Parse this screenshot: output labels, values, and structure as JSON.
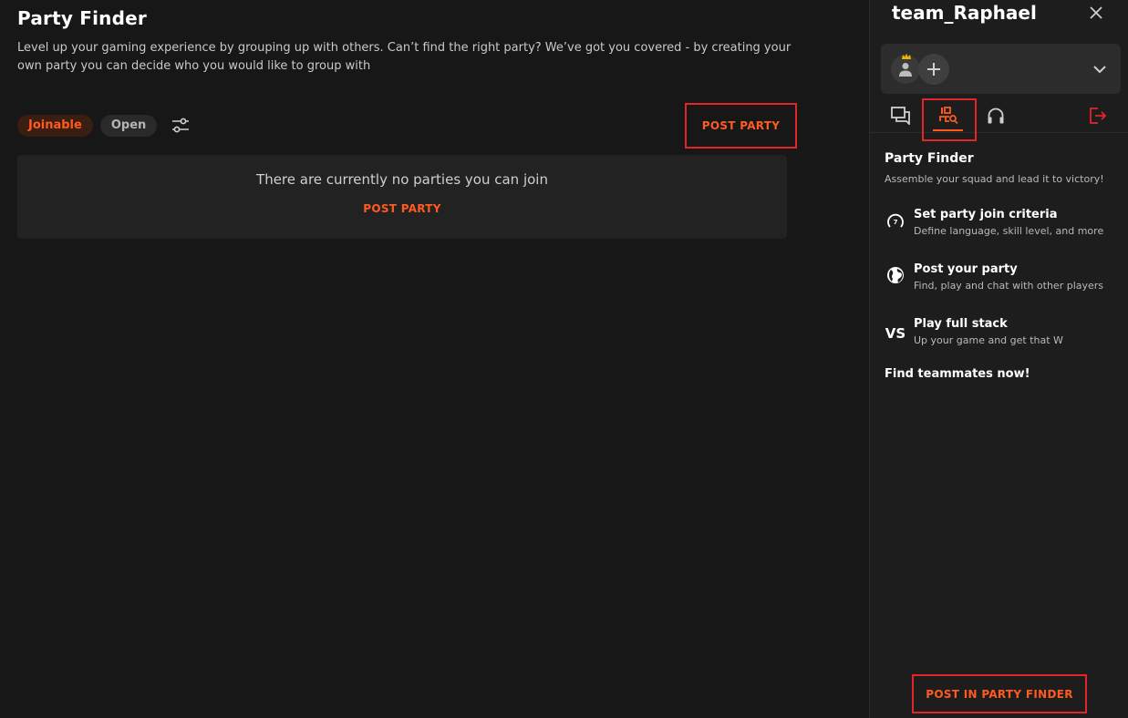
{
  "main": {
    "title": "Party Finder",
    "description": "Level up your gaming experience by grouping up with others. Can’t find the right party? We’ve got you covered - by creating your own party you can decide who you would like to group with",
    "filters": {
      "joinable_label": "Joinable",
      "open_label": "Open",
      "filter_icon": "sliders-icon"
    },
    "post_party_label": "POST PARTY",
    "empty_state": {
      "message": "There are currently no parties you can join",
      "post_party_label": "POST PARTY"
    }
  },
  "panel": {
    "title": "team_Raphael",
    "close_icon": "close-icon",
    "tabs": [
      {
        "icon": "chat-icon"
      },
      {
        "icon": "party-finder-icon",
        "active": true
      },
      {
        "icon": "headphones-icon"
      },
      {
        "icon": "leave-icon"
      }
    ],
    "party_finder": {
      "heading": "Party Finder",
      "subtitle": "Assemble your squad and lead it to victory!",
      "features": [
        {
          "icon": "criteria-gauge-icon",
          "title": "Set party join criteria",
          "desc": "Define language, skill level, and more"
        },
        {
          "icon": "globe-icon",
          "title": "Post your party",
          "desc": "Find, play and chat with other players"
        },
        {
          "icon": "vs-icon",
          "icon_text": "VS",
          "title": "Play full stack",
          "desc": "Up your game and get that W"
        }
      ],
      "cta_text": "Find teammates now!",
      "post_button_label": "POST IN PARTY FINDER"
    }
  },
  "colors": {
    "accent": "#ff5a1f",
    "highlight_border": "#e3242b",
    "background": "#171717",
    "panel_background": "#1d1d1d"
  }
}
